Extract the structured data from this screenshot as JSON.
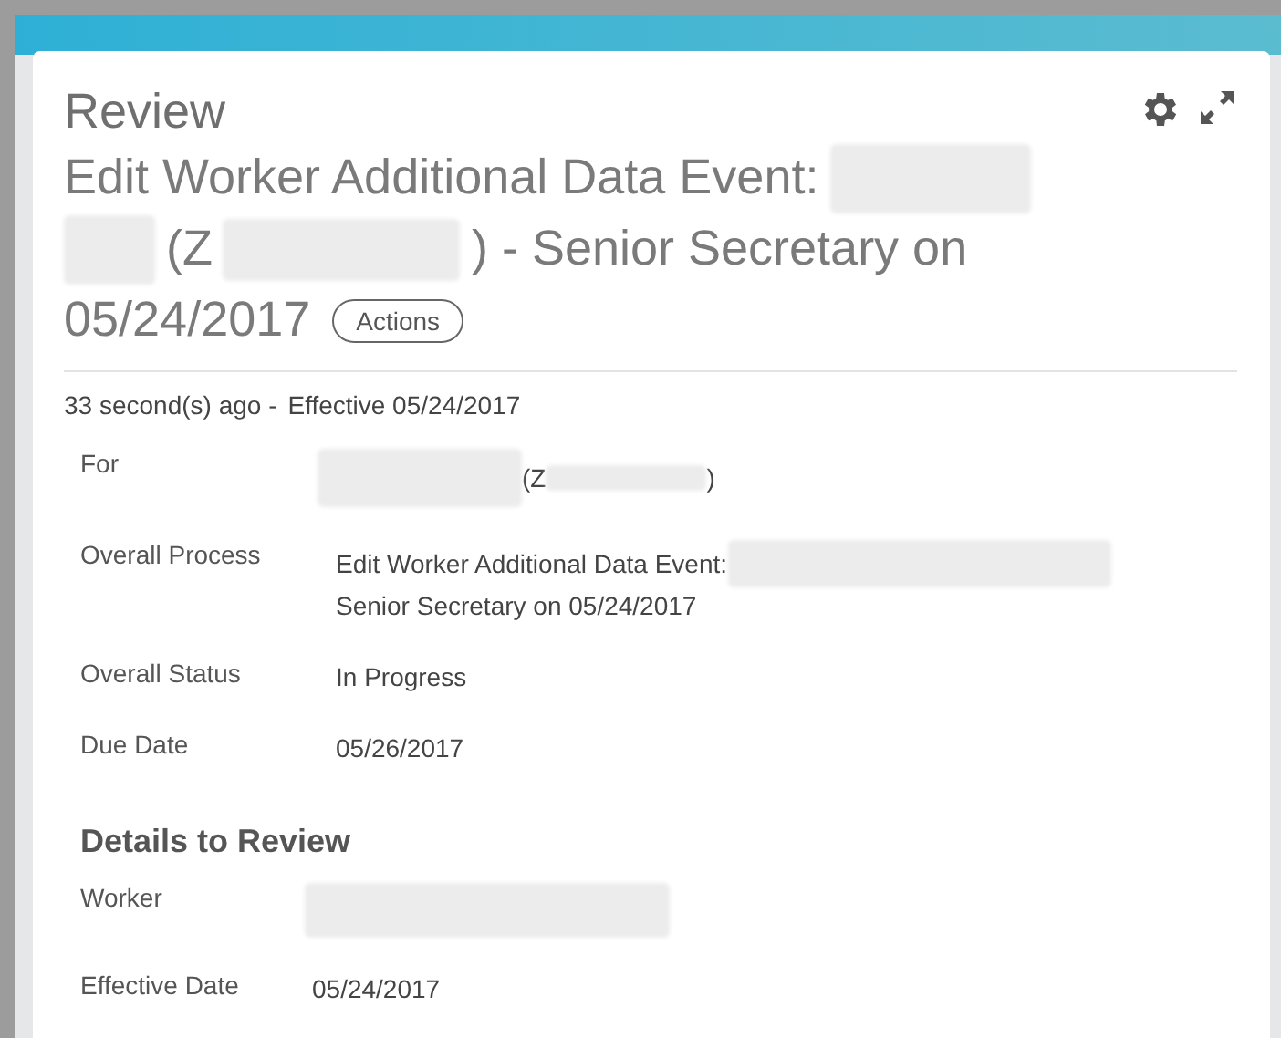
{
  "card": {
    "heading": "Review",
    "title_parts": [
      {
        "kind": "text",
        "text": "Edit Worker Additional Data Event:"
      },
      {
        "kind": "blur"
      },
      {
        "kind": "blur"
      },
      {
        "kind": "text",
        "text": "(Z"
      },
      {
        "kind": "blur"
      },
      {
        "kind": "text",
        "text": ") - Senior Secretary on"
      },
      {
        "kind": "text",
        "text": "05/24/2017"
      }
    ],
    "actions_button": "Actions",
    "meta": {
      "ago": "33 second(s) ago -",
      "effective": "Effective 05/24/2017"
    },
    "fields": [
      {
        "label": "For",
        "parts": [
          {
            "kind": "blur"
          },
          {
            "kind": "text",
            "text": "(Z"
          },
          {
            "kind": "blur"
          },
          {
            "kind": "text",
            "text": ")"
          }
        ]
      },
      {
        "label": "Overall Process",
        "parts": [
          {
            "kind": "text",
            "text": "Edit Worker Additional Data Event:"
          },
          {
            "kind": "blur"
          },
          {
            "kind": "text",
            "text": "Senior Secretary on 05/24/2017"
          }
        ]
      },
      {
        "label": "Overall Status",
        "parts": [
          {
            "kind": "text",
            "text": "In Progress"
          }
        ]
      },
      {
        "label": "Due Date",
        "parts": [
          {
            "kind": "text",
            "text": "05/26/2017"
          }
        ]
      }
    ],
    "section_title": "Details to Review",
    "details": [
      {
        "label": "Worker",
        "parts": [
          {
            "kind": "blur"
          }
        ]
      },
      {
        "label": "Effective Date",
        "parts": [
          {
            "kind": "text",
            "text": "05/24/2017"
          }
        ]
      }
    ]
  }
}
